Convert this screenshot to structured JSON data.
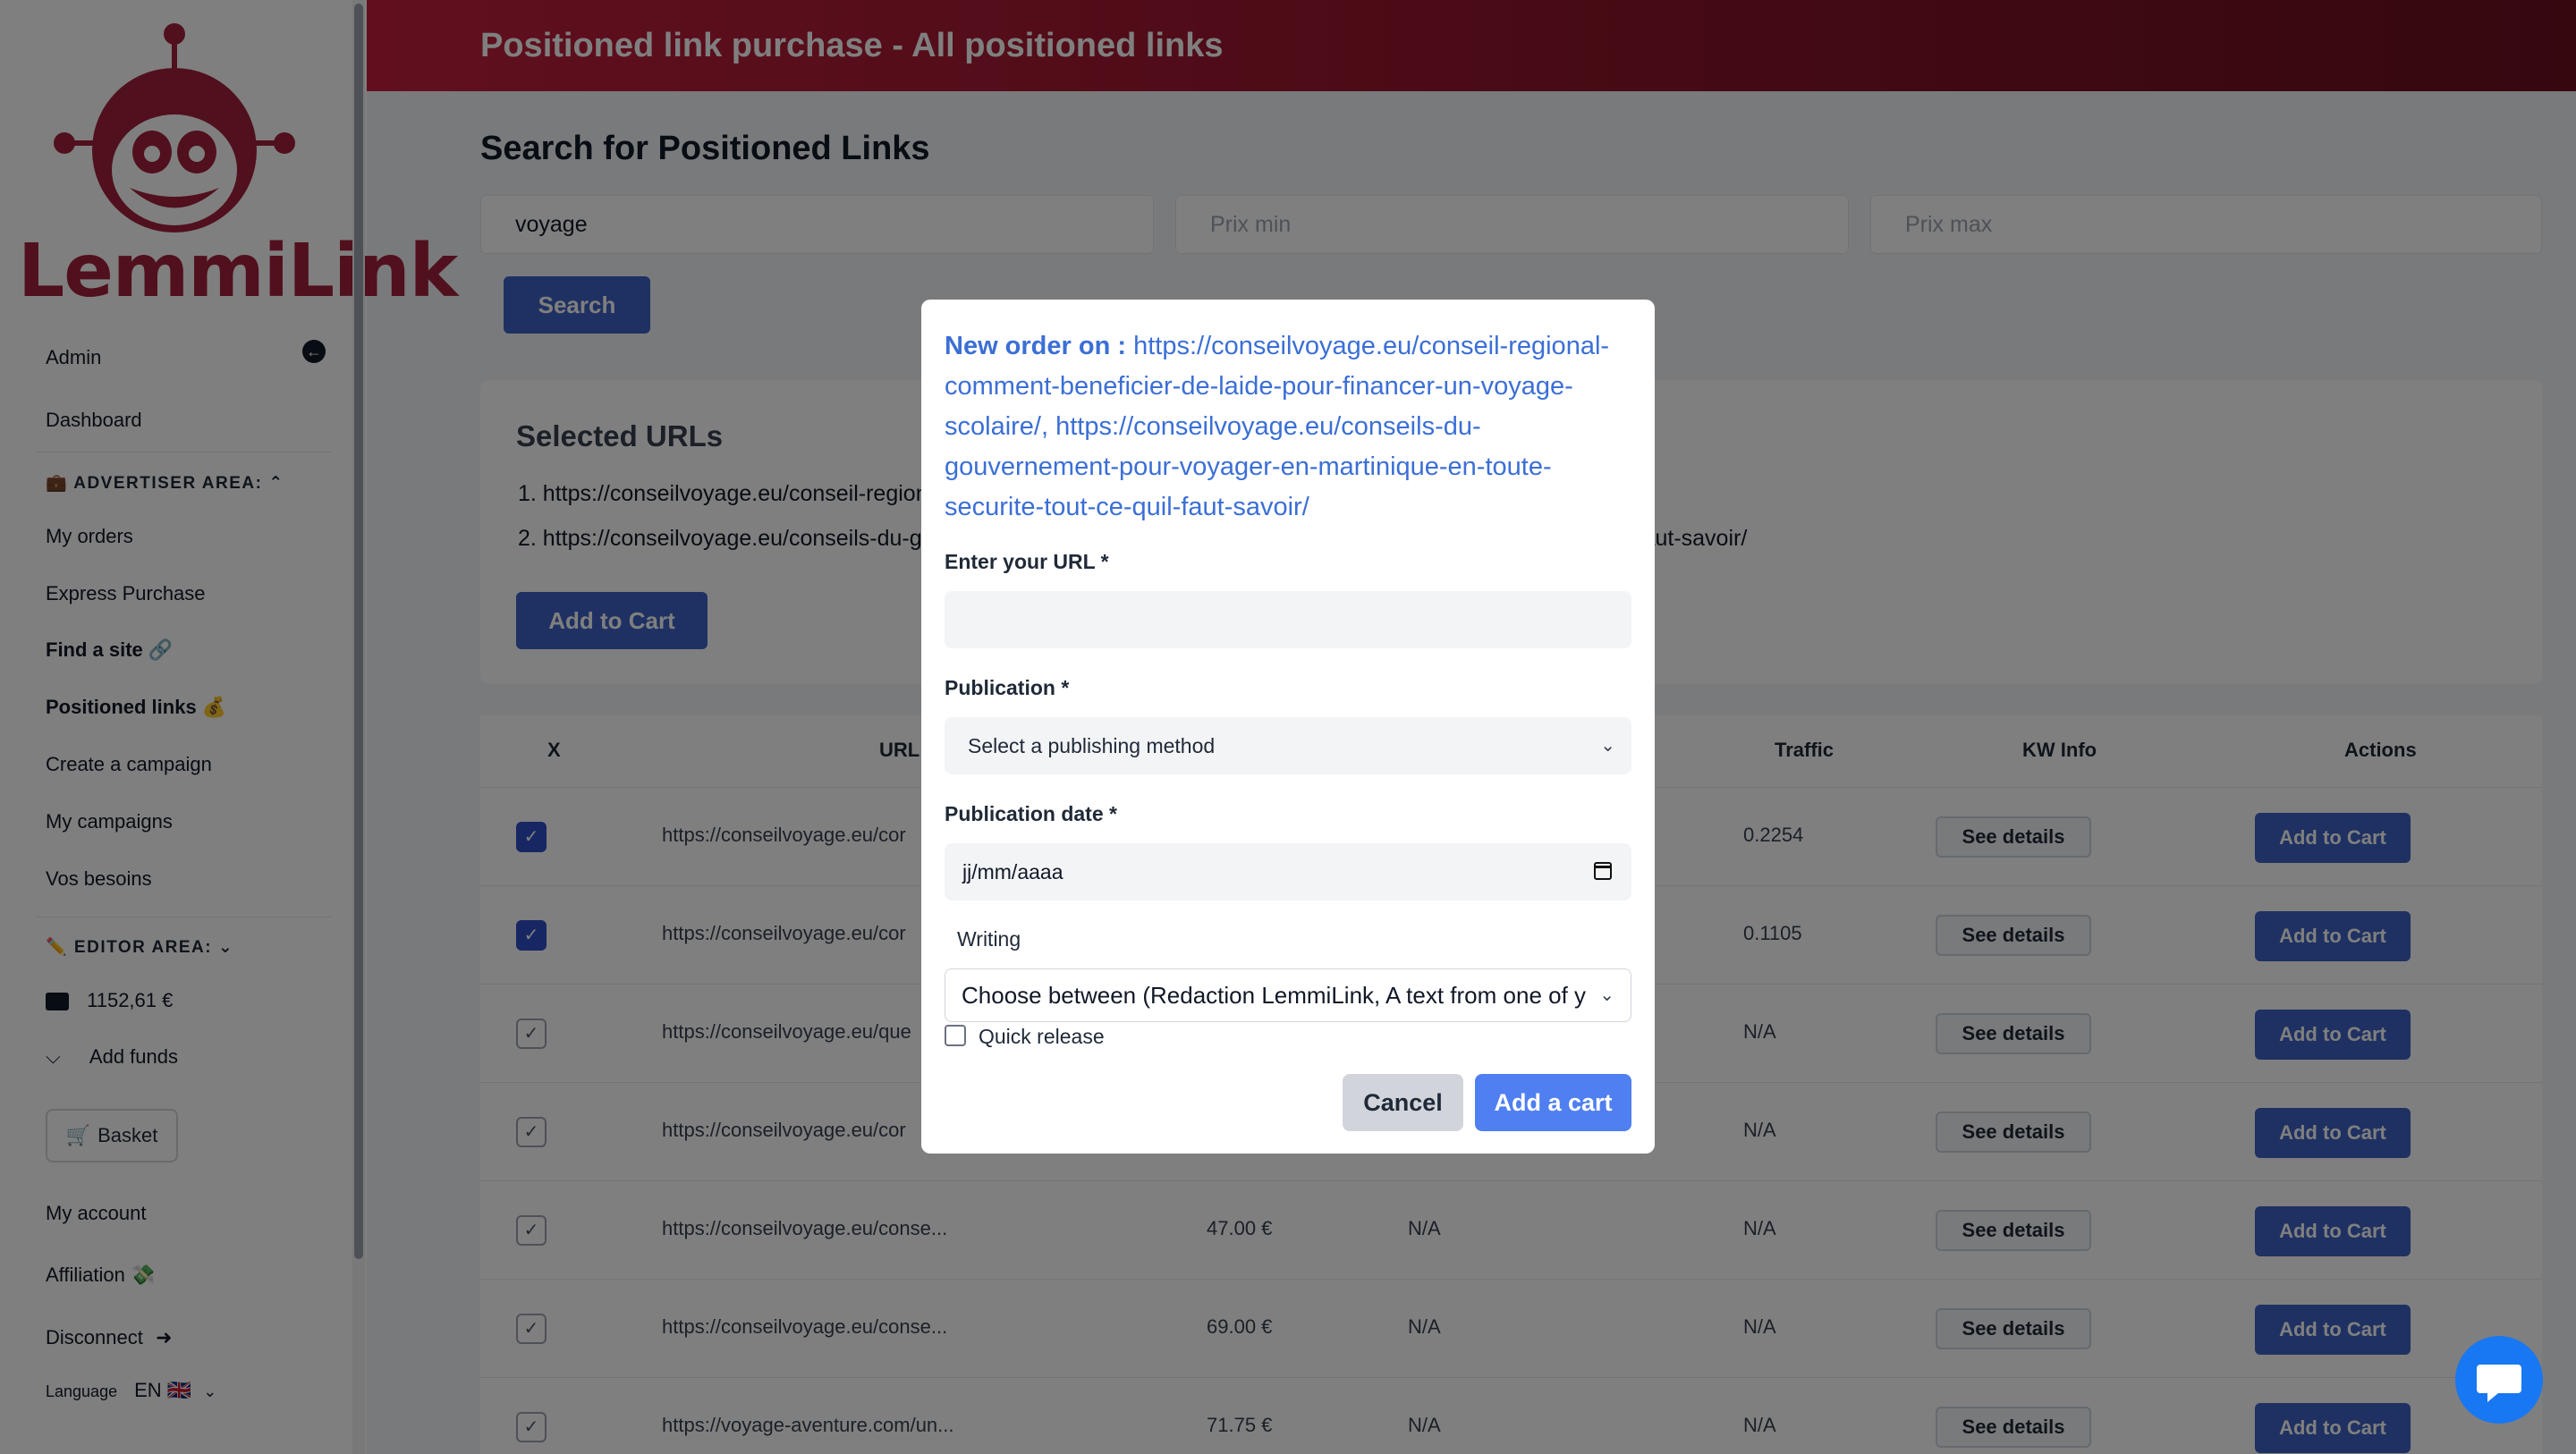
{
  "sidebar": {
    "brand": "LemmiLink",
    "admin": "Admin",
    "dashboard": "Dashboard",
    "advertiser_area": "💼 ADVERTISER AREA:",
    "my_orders": "My orders",
    "express_purchase": "Express Purchase",
    "find_a_site": "Find a site 🔗",
    "positioned_links": "Positioned links 💰",
    "create_campaign": "Create a campaign",
    "my_campaigns": "My campaigns",
    "vos_besoins": "Vos besoins",
    "editor_area": "✏️ EDITOR AREA:",
    "balance": "1152,61 €",
    "add_funds": "Add funds",
    "basket": "Basket",
    "my_account": "My account",
    "affiliation": "Affiliation 💸",
    "disconnect": "Disconnect",
    "language_label": "Language",
    "language_value": "EN 🇬🇧"
  },
  "header": {
    "title": "Positioned link purchase - All positioned links"
  },
  "search": {
    "title": "Search for Positioned Links",
    "query": "voyage",
    "min_placeholder": "Prix min",
    "max_placeholder": "Prix max",
    "button": "Search"
  },
  "selected": {
    "title": "Selected URLs",
    "items": [
      "1. https://conseilvoyage.eu/conseil-regional-comment-beneficier-de-laide-pour-financer-un-voyage-scolaire/",
      "2. https://conseilvoyage.eu/conseils-du-gouvernement-pour-voyager-en-martinique-en-toute-securite-tout-ce-quil-faut-savoir/"
    ],
    "button": "Add to Cart"
  },
  "table": {
    "headers": {
      "x": "X",
      "url": "URL",
      "traffic": "Traffic",
      "kw": "KW Info",
      "actions": "Actions"
    },
    "details_label": "See details",
    "cart_label": "Add to Cart",
    "rows": [
      {
        "checked": true,
        "url": "https://conseilvoyage.eu/cor",
        "price": "",
        "col4": "",
        "traffic": "0.2254"
      },
      {
        "checked": true,
        "url": "https://conseilvoyage.eu/cor",
        "price": "",
        "col4": "",
        "traffic": "0.1105"
      },
      {
        "checked": false,
        "url": "https://conseilvoyage.eu/que",
        "price": "",
        "col4": "",
        "traffic": "N/A"
      },
      {
        "checked": false,
        "url": "https://conseilvoyage.eu/cor",
        "price": "",
        "col4": "",
        "traffic": "N/A"
      },
      {
        "checked": false,
        "url": "https://conseilvoyage.eu/conse...",
        "price": "47.00 €",
        "col4": "N/A",
        "traffic": "N/A"
      },
      {
        "checked": false,
        "url": "https://conseilvoyage.eu/conse...",
        "price": "69.00 €",
        "col4": "N/A",
        "traffic": "N/A"
      },
      {
        "checked": false,
        "url": "https://voyage-aventure.com/un...",
        "price": "71.75 €",
        "col4": "N/A",
        "traffic": "N/A"
      }
    ]
  },
  "modal": {
    "order_prefix": "New order on :",
    "order_urls": "https://conseilvoyage.eu/conseil-regional-comment-beneficier-de-laide-pour-financer-un-voyage-scolaire/, https://conseilvoyage.eu/conseils-du-gouvernement-pour-voyager-en-martinique-en-toute-securite-tout-ce-quil-faut-savoir/",
    "url_label": "Enter your URL *",
    "url_value": "",
    "publication_label": "Publication *",
    "publication_value": "Select a publishing method",
    "date_label": "Publication date *",
    "date_value": "jj/mm/aaaa",
    "writing_label": "Writing",
    "writing_value": "Choose between (Redaction LemmiLink, A text from one of y",
    "quick_release": "Quick release",
    "cancel": "Cancel",
    "add": "Add a cart"
  },
  "colors": {
    "header_start": "#c31f3e",
    "header_end": "#6b0f1f",
    "primary_button": "#3f63c5",
    "modal_link": "#3b6fd6",
    "brand": "#a3213a"
  }
}
